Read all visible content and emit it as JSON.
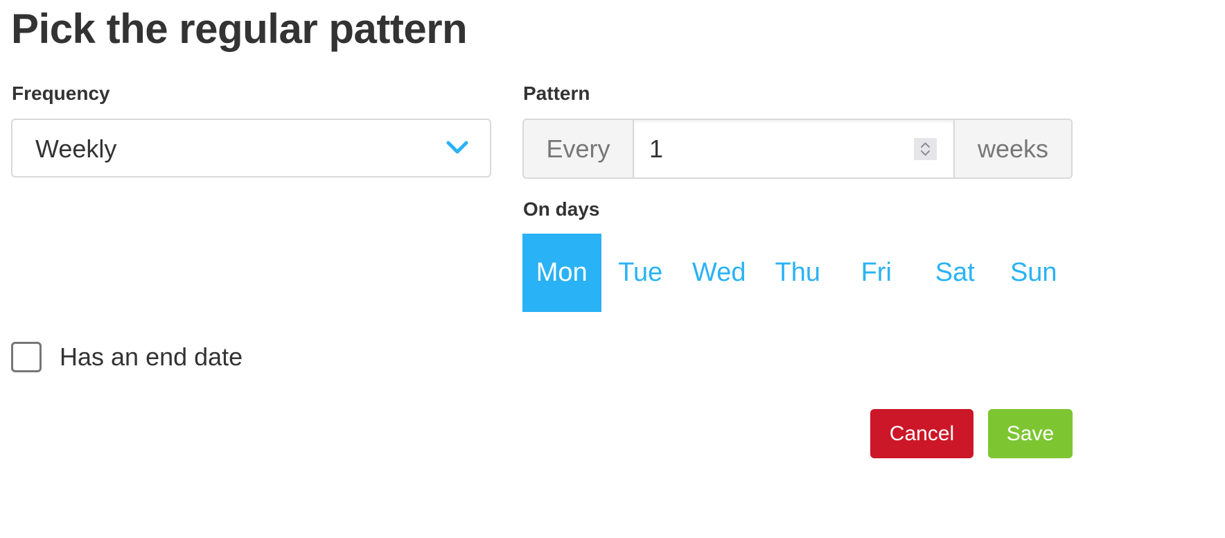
{
  "page": {
    "title": "Pick the regular pattern"
  },
  "frequency": {
    "label": "Frequency",
    "selected": "Weekly",
    "icon": "chevron-down-icon"
  },
  "pattern": {
    "label": "Pattern",
    "prefix": "Every",
    "value": "1",
    "suffix": "weeks",
    "spinner_icon": "up-down-spinner-icon"
  },
  "on_days": {
    "label": "On days",
    "days": [
      {
        "label": "Mon",
        "selected": true
      },
      {
        "label": "Tue",
        "selected": false
      },
      {
        "label": "Wed",
        "selected": false
      },
      {
        "label": "Thu",
        "selected": false
      },
      {
        "label": "Fri",
        "selected": false
      },
      {
        "label": "Sat",
        "selected": false
      },
      {
        "label": "Sun",
        "selected": false
      }
    ]
  },
  "end_date": {
    "label": "Has an end date",
    "checked": false
  },
  "actions": {
    "cancel_label": "Cancel",
    "save_label": "Save"
  },
  "colors": {
    "accent": "#29b2f5",
    "cancel": "#cc1728",
    "save": "#7dc632",
    "text": "#333333"
  }
}
